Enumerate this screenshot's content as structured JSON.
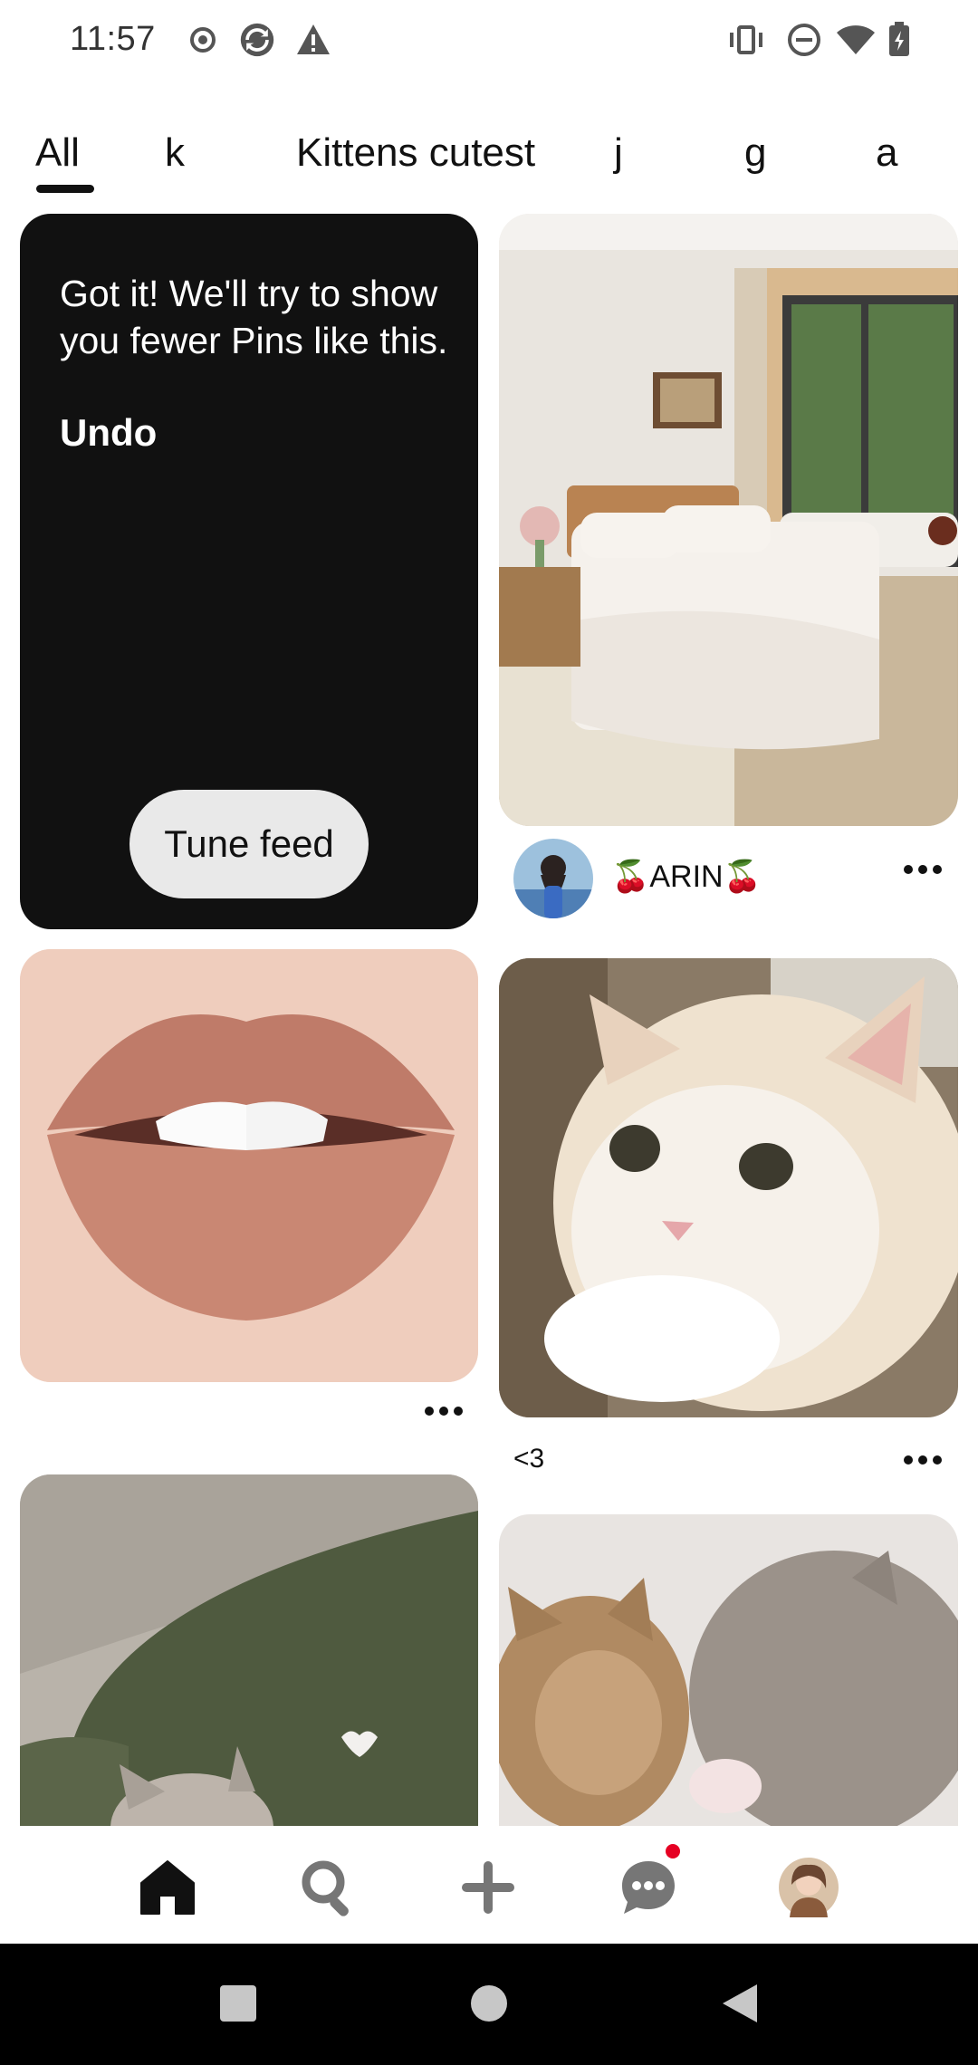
{
  "status_bar": {
    "time": "11:57",
    "left_icons": [
      "record-icon",
      "sync-app-icon",
      "warning-icon"
    ],
    "right_icons": [
      "vibrate-icon",
      "do-not-disturb-icon",
      "wifi-icon",
      "battery-charging-icon"
    ]
  },
  "tabs": {
    "items": [
      {
        "label": "All",
        "active": true
      },
      {
        "label": "k",
        "active": false
      },
      {
        "label": "Kittens cutest",
        "active": false
      },
      {
        "label": "j",
        "active": false
      },
      {
        "label": "g",
        "active": false
      },
      {
        "label": "a",
        "active": false
      }
    ]
  },
  "feed": {
    "notice": {
      "message": "Got it! We'll try to show you fewer Pins like this.",
      "undo_label": "Undo",
      "tune_button_label": "Tune feed"
    },
    "pins": [
      {
        "image": "bedroom-photo",
        "author": "🍒ARIN🍒",
        "has_avatar": true
      },
      {
        "image": "lips-photo",
        "title": ""
      },
      {
        "image": "kitten-photo",
        "title": "<3"
      },
      {
        "image": "sofa-kitten-photo"
      },
      {
        "image": "two-kittens-photo"
      }
    ]
  },
  "bottom_nav": {
    "items": [
      "home-icon",
      "search-icon",
      "create-icon",
      "messages-icon",
      "profile-avatar"
    ],
    "active": "home-icon",
    "messages_badge": true
  },
  "system_nav": [
    "recents-button",
    "home-button",
    "back-button"
  ],
  "colors": {
    "notice_bg": "#111111",
    "tune_button_bg": "#e9e9e9",
    "badge": "#e60023"
  }
}
